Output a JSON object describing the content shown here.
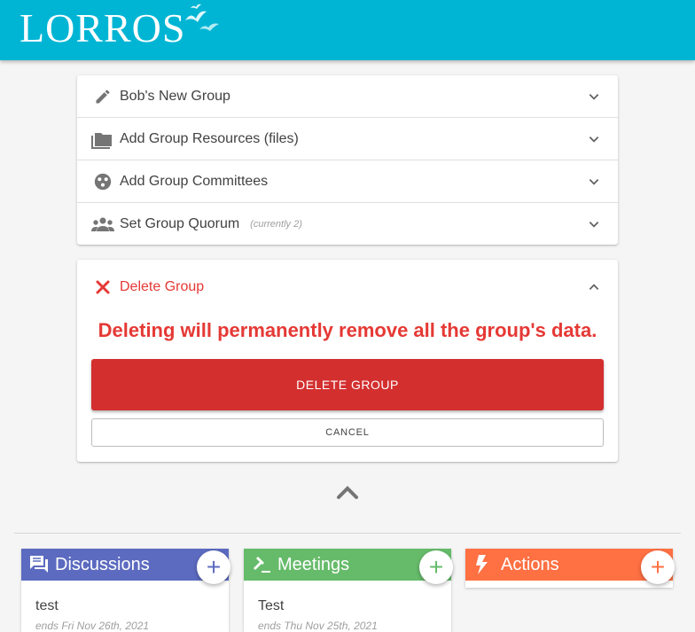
{
  "header": {
    "logo_text": "LORROS",
    "brand_color": "#00b5d4"
  },
  "panels": [
    {
      "title": "Bob's New Group",
      "icon": "pencil-icon",
      "note": ""
    },
    {
      "title": "Add Group Resources (files)",
      "icon": "folder-icon",
      "note": ""
    },
    {
      "title": "Add Group Committees",
      "icon": "committees-icon",
      "note": ""
    },
    {
      "title": "Set Group Quorum",
      "icon": "people-icon",
      "note": "(currently 2)"
    }
  ],
  "delete_panel": {
    "title": "Delete Group",
    "warning": "Deleting will permanently remove all the group's data.",
    "delete_button": "DELETE GROUP",
    "cancel_button": "CANCEL",
    "accent_color": "#e53935"
  },
  "cards": [
    {
      "title": "Discussions",
      "color": "#5c6bc0",
      "item_title": "test",
      "item_sub": "ends Fri Nov 26th, 2021",
      "add": "+"
    },
    {
      "title": "Meetings",
      "color": "#66bb6a",
      "item_title": "Test",
      "item_sub": "ends Thu Nov 25th, 2021",
      "add": "+"
    },
    {
      "title": "Actions",
      "color": "#ff7043",
      "add": "+"
    }
  ]
}
